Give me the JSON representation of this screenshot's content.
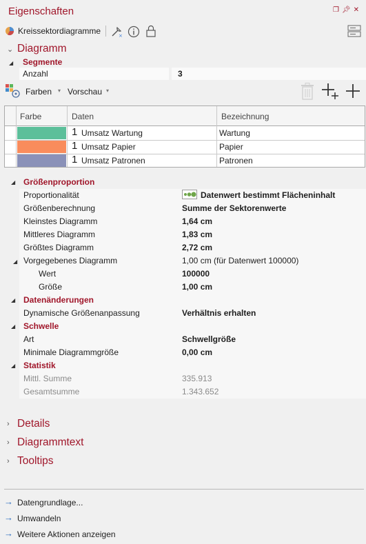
{
  "panel": {
    "title": "Eigenschaften"
  },
  "toolbar": {
    "object_type": "Kreissektordiagramme"
  },
  "diagramm": {
    "header": "Diagramm",
    "segmente": {
      "label": "Segmente",
      "anzahl_label": "Anzahl",
      "anzahl_value": "3"
    },
    "grid_toolbar": {
      "farben": "Farben",
      "vorschau": "Vorschau"
    },
    "table": {
      "columns": [
        "Farbe",
        "Daten",
        "Bezeichnung"
      ],
      "rows": [
        {
          "color": "#5cbf9a",
          "num": "1",
          "daten": "Umsatz Wartung",
          "bezeichnung": "Wartung"
        },
        {
          "color": "#f98c5c",
          "num": "1",
          "daten": "Umsatz Papier",
          "bezeichnung": "Papier"
        },
        {
          "color": "#8a91b8",
          "num": "1",
          "daten": "Umsatz Patronen",
          "bezeichnung": "Patronen"
        }
      ]
    }
  },
  "groessenproportion": {
    "label": "Größenproportion",
    "proportionalitaet_label": "Proportionalität",
    "proportionalitaet_value": "Datenwert bestimmt Flächeninhalt",
    "groessenberechnung_label": "Größenberechnung",
    "groessenberechnung_value": "Summe der Sektorenwerte",
    "kleinstes_label": "Kleinstes Diagramm",
    "kleinstes_value": "1,64 cm",
    "mittleres_label": "Mittleres Diagramm",
    "mittleres_value": "1,83 cm",
    "groesstes_label": "Größtes Diagramm",
    "groesstes_value": "2,72 cm",
    "vorgegeben_label": "Vorgegebenes Diagramm",
    "vorgegeben_value": "1,00 cm (für Datenwert 100000)",
    "wert_label": "Wert",
    "wert_value": "100000",
    "groesse_label": "Größe",
    "groesse_value": "1,00 cm"
  },
  "datenaenderungen": {
    "label": "Datenänderungen",
    "dyn_label": "Dynamische Größenanpassung",
    "dyn_value": "Verhältnis erhalten"
  },
  "schwelle": {
    "label": "Schwelle",
    "art_label": "Art",
    "art_value": "Schwellgröße",
    "min_label": "Minimale Diagrammgröße",
    "min_value": "0,00 cm"
  },
  "statistik": {
    "label": "Statistik",
    "mittl_label": "Mittl. Summe",
    "mittl_value": "335.913",
    "gesamt_label": "Gesamtsumme",
    "gesamt_value": "1.343.652"
  },
  "collapsed_sections": {
    "details": "Details",
    "diagrammtext": "Diagrammtext",
    "tooltips": "Tooltips"
  },
  "links": {
    "datengrundlage": "Datengrundlage...",
    "umwandeln": "Umwandeln",
    "weitere": "Weitere Aktionen anzeigen"
  }
}
